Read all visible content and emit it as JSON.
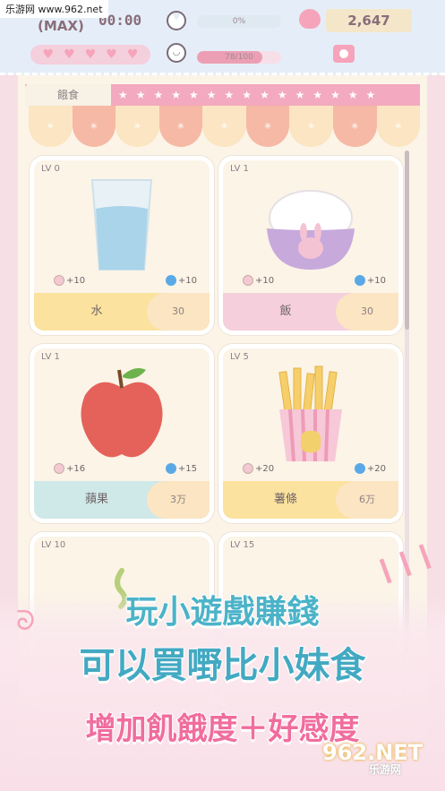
{
  "watermark_top": "乐游网 www.962.net",
  "hud": {
    "max_label": "(MAX)",
    "timer": "00:00",
    "hearts": [
      "♥",
      "♥",
      "♥",
      "♥",
      "♥"
    ],
    "hunger_bar_text": "0%",
    "hunger_level": 0,
    "favor_bar_text": "78/100",
    "favor_level": 0.78,
    "money": "2,647"
  },
  "tabs": {
    "food_label": "餓食",
    "stars": "★★★★★★★★★★★★★★★"
  },
  "items": [
    {
      "lv": "LV 0",
      "name": "水",
      "price": "30",
      "stat_a": "+10",
      "stat_b": "+10",
      "band": "yellow"
    },
    {
      "lv": "LV 1",
      "name": "飯",
      "price": "30",
      "stat_a": "+10",
      "stat_b": "+10",
      "band": "pink"
    },
    {
      "lv": "LV 1",
      "name": "蘋果",
      "price": "3万",
      "stat_a": "+16",
      "stat_b": "+15",
      "band": "teal"
    },
    {
      "lv": "LV 5",
      "name": "薯條",
      "price": "6万",
      "stat_a": "+20",
      "stat_b": "+20",
      "band": "yellow"
    },
    {
      "lv": "LV 10",
      "name": "",
      "price": "",
      "stat_a": "",
      "stat_b": "",
      "band": "yellow"
    },
    {
      "lv": "LV 15",
      "name": "",
      "price": "",
      "stat_a": "",
      "stat_b": "",
      "band": "pink"
    }
  ],
  "promo": {
    "line1": "玩小遊戲賺錢",
    "line2": "可以買嘢比小妹食",
    "line3": "增加飢餓度＋好感度"
  },
  "watermark_bottom": {
    "logo": "962.NET",
    "site": "乐游网"
  },
  "colors": {
    "accent_pink": "#f3a9bf",
    "accent_blue": "#4bb3c8",
    "promo_pink": "#f06d9d"
  }
}
